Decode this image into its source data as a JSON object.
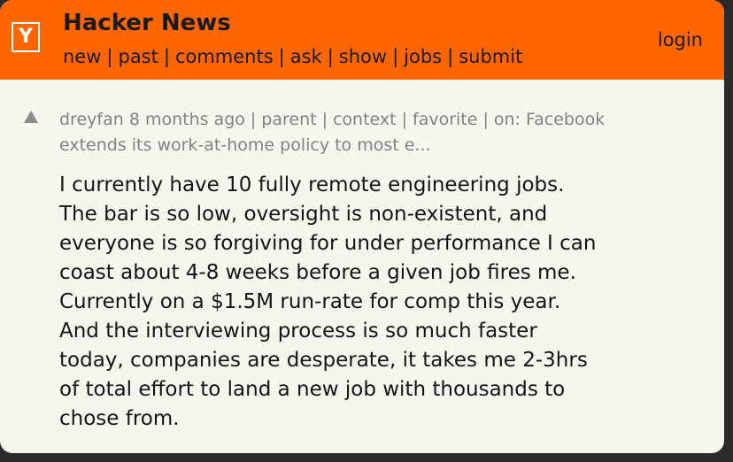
{
  "header": {
    "logo": "Y",
    "title": "Hacker News",
    "nav": [
      "new",
      "past",
      "comments",
      "ask",
      "show",
      "jobs",
      "submit"
    ],
    "login": "login"
  },
  "comment": {
    "user": "dreyfan",
    "age": "8 months ago",
    "links": [
      "parent",
      "context",
      "favorite"
    ],
    "on_label": "on:",
    "story_title_line1": "Facebook",
    "story_title_line2": "extends its work-at-home policy to most e...",
    "text_lines": [
      "I currently have 10 fully remote engineering jobs.",
      "The bar is so low, oversight is non-existent, and",
      "everyone is so forgiving for under performance I can",
      "coast about 4-8 weeks before a given job fires me.",
      "Currently on a $1.5M run-rate for comp this year.",
      "And the interviewing process is so much faster",
      "today, companies are desperate, it takes me 2-3hrs",
      "of total effort to land a new job with thousands to",
      "chose from."
    ]
  },
  "colors": {
    "header": "#ff6600",
    "background": "#f6f6ef",
    "meta_text": "#828282"
  }
}
